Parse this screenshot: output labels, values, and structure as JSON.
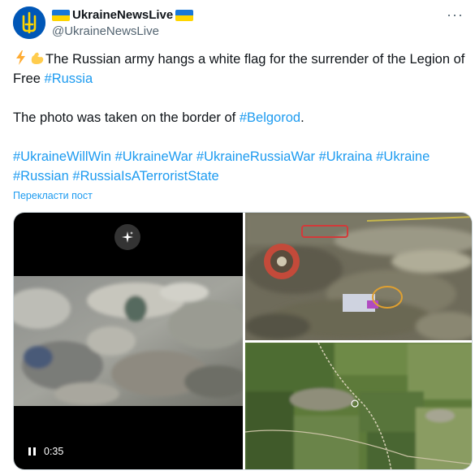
{
  "account": {
    "display_name": "UkraineNewsLive",
    "handle": "@UkraineNewsLive",
    "avatar_icon": "ukraine-trident-icon",
    "flag_colors": [
      "#1877d8",
      "#ffd500"
    ]
  },
  "tweet": {
    "line1_text": "The Russian army hangs a white flag for the surrender of the Legion of Free ",
    "line1_tag": "#Russia",
    "line2_text": "The photo was taken on the border of ",
    "line2_tag": "#Belgorod",
    "line2_end": ".",
    "hashtags": [
      "#UkraineWillWin",
      "#UkraineWar",
      "#UkraineRussiaWar",
      "#Ukraina",
      "#Ukraine",
      "#Russian",
      "#RussiaIsATerroristState"
    ],
    "emoji_icons": [
      "lightning-icon",
      "flexed-bicep-icon"
    ]
  },
  "translate_link": "Перекласти пост",
  "more_icon": "more-dots-icon",
  "media": {
    "video_time": "0:35",
    "sparkle_icon": "sparkle-icon",
    "pause_icon": "pause-icon"
  },
  "colors": {
    "link": "#1d9bf0",
    "text": "#0f1419",
    "secondary": "#536471"
  }
}
